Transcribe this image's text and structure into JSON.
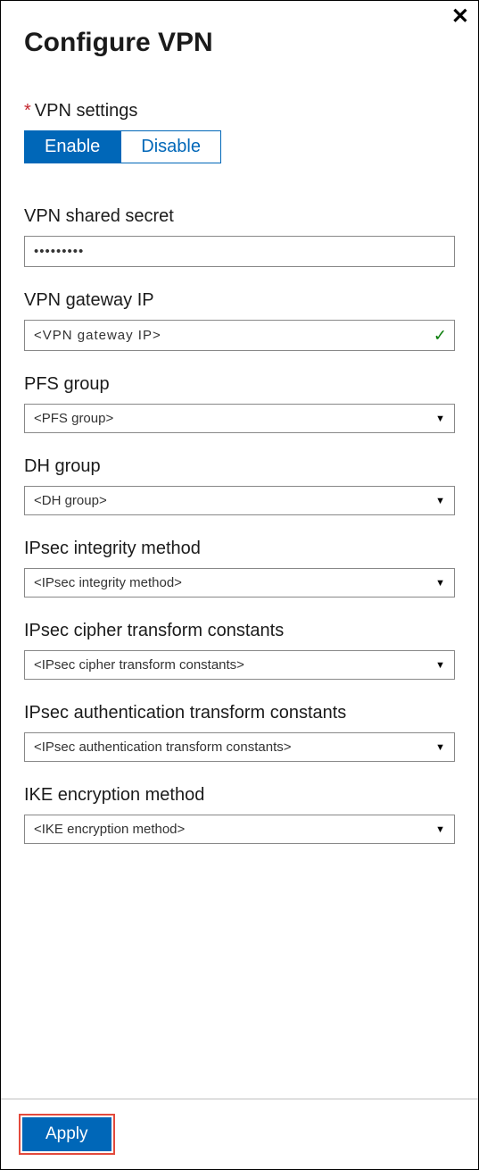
{
  "title": "Configure VPN",
  "close_label": "✕",
  "settings": {
    "label": "VPN settings",
    "required_mark": "*",
    "enable_label": "Enable",
    "disable_label": "Disable"
  },
  "fields": {
    "shared_secret": {
      "label": "VPN shared secret",
      "value": "•••••••••"
    },
    "gateway_ip": {
      "label": "VPN gateway IP",
      "value": "<VPN gateway IP>"
    },
    "pfs_group": {
      "label": "PFS group",
      "value": "<PFS group>"
    },
    "dh_group": {
      "label": "DH group",
      "value": "<DH group>"
    },
    "ipsec_integrity": {
      "label": "IPsec integrity method",
      "value": "<IPsec integrity method>"
    },
    "ipsec_cipher": {
      "label": "IPsec cipher transform constants",
      "value": "<IPsec cipher transform constants>"
    },
    "ipsec_auth": {
      "label": "IPsec authentication transform constants",
      "value": "<IPsec authentication transform constants>"
    },
    "ike_encrypt": {
      "label": "IKE encryption method",
      "value": "<IKE encryption method>"
    }
  },
  "apply_label": "Apply"
}
